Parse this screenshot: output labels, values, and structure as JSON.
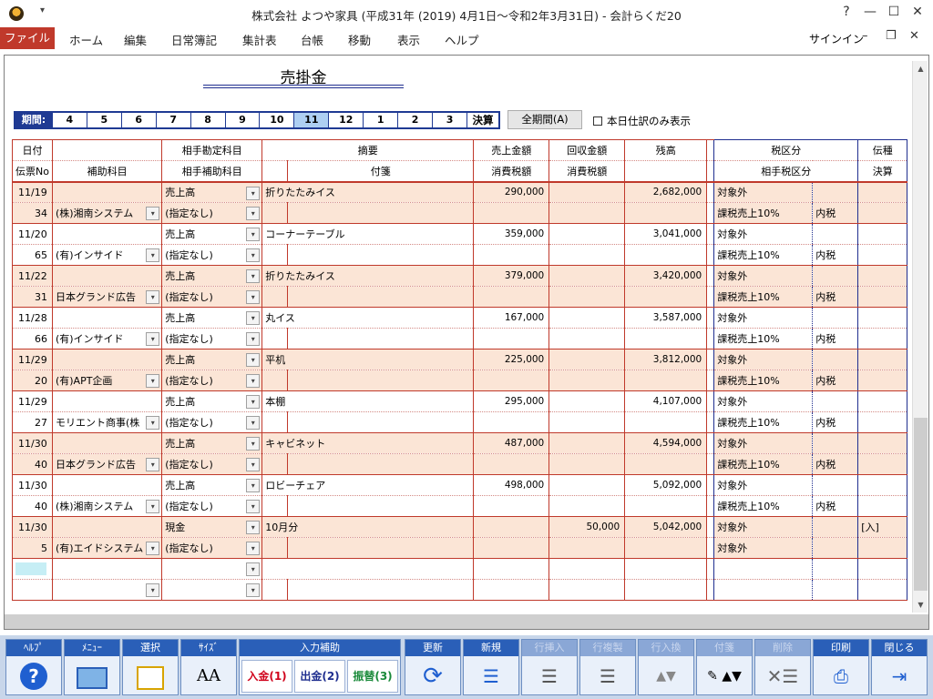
{
  "window": {
    "title": "株式会社 よつや家具 (平成31年 (2019) 4月1日～令和2年3月31日) - 会計らくだ20",
    "help": "?",
    "minimize": "—",
    "maximize": "☐",
    "close": "✕"
  },
  "menu": {
    "file": "ファイル",
    "items": [
      "ホーム",
      "編集",
      "日常簿記",
      "集計表",
      "台帳",
      "移動",
      "表示",
      "ヘルプ"
    ],
    "signin": "サインイン"
  },
  "form": {
    "title": "売掛金",
    "period_label": "期間:",
    "periods": [
      "4",
      "5",
      "6",
      "7",
      "8",
      "9",
      "10",
      "11",
      "12",
      "1",
      "2",
      "3"
    ],
    "selected_period": "11",
    "closing": "決算",
    "all_period": "全期間(A)",
    "today_only": "本日仕訳のみ表示"
  },
  "headers": {
    "row1": {
      "date": "日付",
      "blank": "",
      "counter_account": "相手勘定科目",
      "summary": "摘要",
      "sales": "売上金額",
      "collected": "回収金額",
      "balance": "残高",
      "tax": "税区分",
      "slip_kind": "伝種"
    },
    "row2": {
      "slip_no": "伝票No",
      "sub_account": "補助科目",
      "counter_sub": "相手補助科目",
      "note": "付箋",
      "sales_tax": "消費税額",
      "collected_tax": "消費税額",
      "counter_tax": "相手税区分",
      "closing": "決算"
    }
  },
  "entries": [
    {
      "date": "11/19",
      "slip": "34",
      "sub": "(株)湘南システム",
      "account": "売上高",
      "counter_sub": "(指定なし)",
      "summary": "折りたたみイス",
      "sales": "290,000",
      "collected": "",
      "balance": "2,682,000",
      "tax": "対象外",
      "tax_detail": "",
      "counter_tax": "課税売上10%",
      "counter_tax_detail": "内税",
      "kind": ""
    },
    {
      "date": "11/20",
      "slip": "65",
      "sub": "(有)インサイド",
      "account": "売上高",
      "counter_sub": "(指定なし)",
      "summary": "コーナーテーブル",
      "sales": "359,000",
      "collected": "",
      "balance": "3,041,000",
      "tax": "対象外",
      "tax_detail": "",
      "counter_tax": "課税売上10%",
      "counter_tax_detail": "内税",
      "kind": ""
    },
    {
      "date": "11/22",
      "slip": "31",
      "sub": "日本グランド広告",
      "account": "売上高",
      "counter_sub": "(指定なし)",
      "summary": "折りたたみイス",
      "sales": "379,000",
      "collected": "",
      "balance": "3,420,000",
      "tax": "対象外",
      "tax_detail": "",
      "counter_tax": "課税売上10%",
      "counter_tax_detail": "内税",
      "kind": ""
    },
    {
      "date": "11/28",
      "slip": "66",
      "sub": "(有)インサイド",
      "account": "売上高",
      "counter_sub": "(指定なし)",
      "summary": "丸イス",
      "sales": "167,000",
      "collected": "",
      "balance": "3,587,000",
      "tax": "対象外",
      "tax_detail": "",
      "counter_tax": "課税売上10%",
      "counter_tax_detail": "内税",
      "kind": ""
    },
    {
      "date": "11/29",
      "slip": "20",
      "sub": "(有)APT企画",
      "account": "売上高",
      "counter_sub": "(指定なし)",
      "summary": "平机",
      "sales": "225,000",
      "collected": "",
      "balance": "3,812,000",
      "tax": "対象外",
      "tax_detail": "",
      "counter_tax": "課税売上10%",
      "counter_tax_detail": "内税",
      "kind": ""
    },
    {
      "date": "11/29",
      "slip": "27",
      "sub": "モリエント商事(株",
      "account": "売上高",
      "counter_sub": "(指定なし)",
      "summary": "本棚",
      "sales": "295,000",
      "collected": "",
      "balance": "4,107,000",
      "tax": "対象外",
      "tax_detail": "",
      "counter_tax": "課税売上10%",
      "counter_tax_detail": "内税",
      "kind": ""
    },
    {
      "date": "11/30",
      "slip": "40",
      "sub": "日本グランド広告",
      "account": "売上高",
      "counter_sub": "(指定なし)",
      "summary": "キャビネット",
      "sales": "487,000",
      "collected": "",
      "balance": "4,594,000",
      "tax": "対象外",
      "tax_detail": "",
      "counter_tax": "課税売上10%",
      "counter_tax_detail": "内税",
      "kind": ""
    },
    {
      "date": "11/30",
      "slip": "40",
      "sub": "(株)湘南システム",
      "account": "売上高",
      "counter_sub": "(指定なし)",
      "summary": "ロビーチェア",
      "sales": "498,000",
      "collected": "",
      "balance": "5,092,000",
      "tax": "対象外",
      "tax_detail": "",
      "counter_tax": "課税売上10%",
      "counter_tax_detail": "内税",
      "kind": ""
    },
    {
      "date": "11/30",
      "slip": "5",
      "sub": "(有)エイドシステム",
      "account": "現金",
      "counter_sub": "(指定なし)",
      "summary": "10月分",
      "sales": "",
      "collected": "50,000",
      "balance": "5,042,000",
      "tax": "対象外",
      "tax_detail": "",
      "counter_tax": "対象外",
      "counter_tax_detail": "",
      "kind": "[入]"
    }
  ],
  "toolbar": {
    "help": "ﾍﾙﾌﾟ",
    "menu": "ﾒﾆｭｰ",
    "select": "選択",
    "size": "ｻｲｽﾞ",
    "size_icon": "AA",
    "input_assist": "入力補助",
    "deposit": "入金(1)",
    "withdraw": "出金(2)",
    "transfer": "振替(3)",
    "update": "更新",
    "new": "新規",
    "insert_row": "行挿入",
    "copy_row": "行複製",
    "swap_row": "行入換",
    "sticky": "付箋",
    "delete": "削除",
    "print": "印刷",
    "close": "閉じる",
    "accent": "#2a5fb8",
    "deposit_color": "#d0021b",
    "withdraw_color": "#1f2e8f",
    "transfer_color": "#1a8a3a"
  }
}
